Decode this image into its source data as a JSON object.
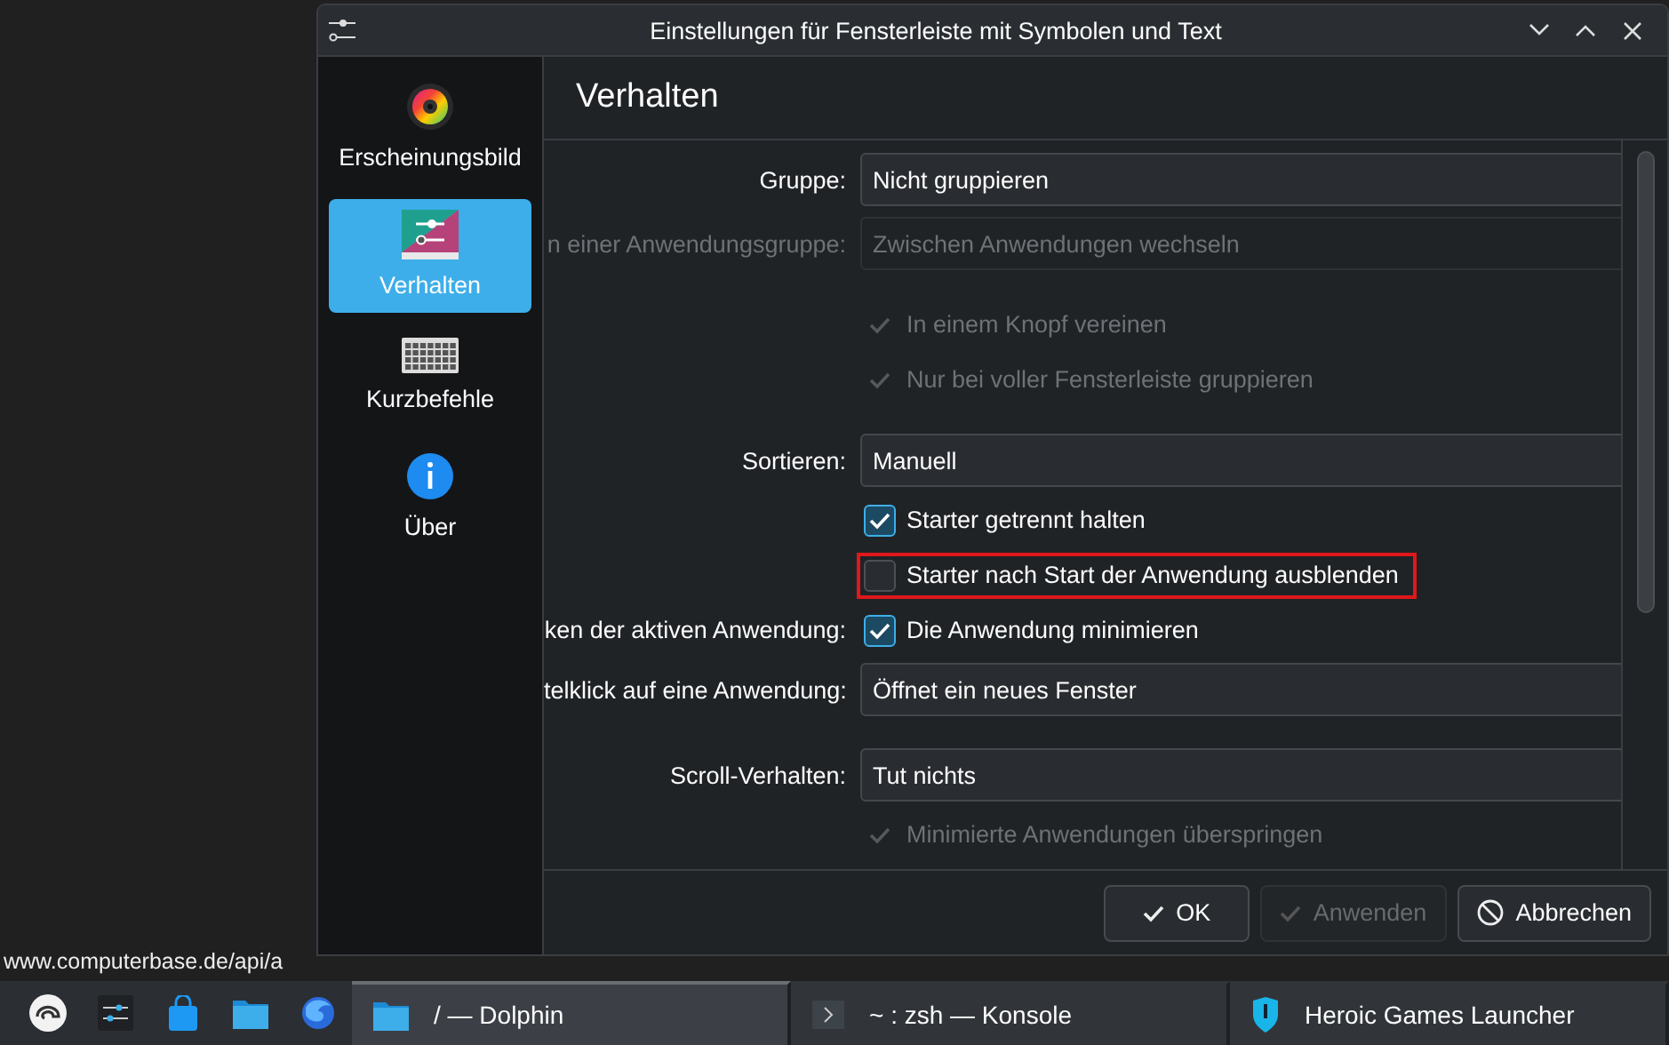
{
  "window": {
    "title": "Einstellungen für Fensterleiste mit Symbolen und Text"
  },
  "sidebar": {
    "items": [
      {
        "label": "Erscheinungsbild",
        "kind": "appearance",
        "selected": false
      },
      {
        "label": "Verhalten",
        "kind": "behavior",
        "selected": true
      },
      {
        "label": "Kurzbefehle",
        "kind": "shortcuts",
        "selected": false
      },
      {
        "label": "Über",
        "kind": "about",
        "selected": false
      }
    ]
  },
  "page_title": "Verhalten",
  "form": {
    "sections": [
      {
        "rows": [
          {
            "kind": "select",
            "label": "Gruppe:",
            "value": "Nicht gruppieren",
            "disabled": false
          },
          {
            "kind": "select",
            "label": "n einer Anwendungsgruppe:",
            "value": "Zwischen Anwendungen wechseln",
            "disabled": true
          }
        ]
      },
      {
        "rows": [
          {
            "kind": "check",
            "text": "In einem Knopf vereinen",
            "checked": true,
            "disabled": true
          },
          {
            "kind": "check",
            "text": "Nur bei voller Fensterleiste gruppieren",
            "checked": true,
            "disabled": true
          }
        ]
      },
      {
        "rows": [
          {
            "kind": "select",
            "label": "Sortieren:",
            "value": "Manuell",
            "disabled": false
          },
          {
            "kind": "check",
            "text": "Starter getrennt halten",
            "checked": true,
            "disabled": false
          },
          {
            "kind": "check",
            "text": "Starter nach Start der Anwendung ausblenden",
            "checked": false,
            "disabled": false,
            "highlighted": true
          },
          {
            "kind": "check",
            "label": "ken der aktiven Anwendung:",
            "text": "Die Anwendung minimieren",
            "checked": true,
            "disabled": false
          },
          {
            "kind": "select",
            "label": "telklick auf eine Anwendung:",
            "value": "Öffnet ein neues Fenster",
            "disabled": false
          }
        ]
      },
      {
        "rows": [
          {
            "kind": "select",
            "label": "Scroll-Verhalten:",
            "value": "Tut nichts",
            "disabled": false
          },
          {
            "kind": "check",
            "text": "Minimierte Anwendungen überspringen",
            "checked": true,
            "disabled": true
          }
        ]
      }
    ]
  },
  "buttons": [
    {
      "label": "OK",
      "kind": "ok",
      "disabled": false
    },
    {
      "label": "Anwenden",
      "kind": "apply",
      "disabled": true
    },
    {
      "label": "Abbrechen",
      "kind": "cancel",
      "disabled": false
    }
  ],
  "status_text": "www.computerbase.de/api/a",
  "taskbar": {
    "launchers": [
      {
        "kind": "distro"
      },
      {
        "kind": "settings"
      },
      {
        "kind": "store"
      },
      {
        "kind": "files"
      },
      {
        "kind": "browser"
      }
    ],
    "tasks": [
      {
        "label": "/ — Dolphin",
        "kind": "files",
        "selected": true
      },
      {
        "label": "~ : zsh — Konsole",
        "kind": "terminal",
        "selected": false
      },
      {
        "label": "Heroic Games Launcher",
        "kind": "game",
        "selected": false
      }
    ]
  }
}
